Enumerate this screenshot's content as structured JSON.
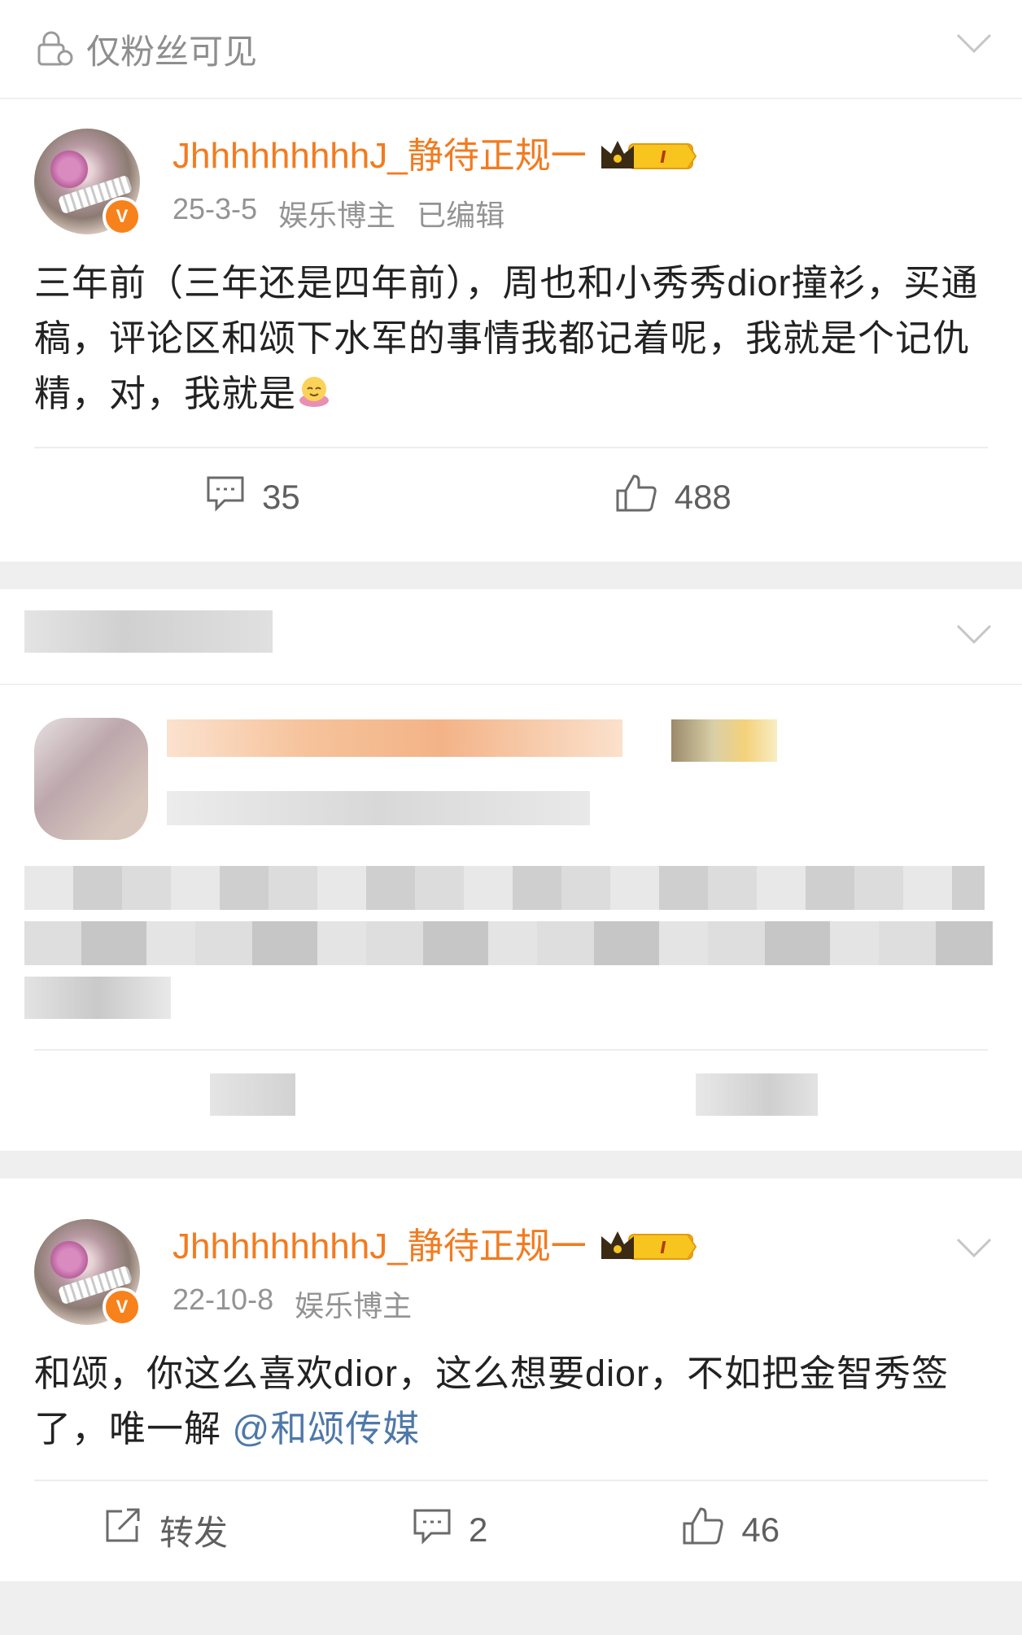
{
  "post1": {
    "visibility_label": "仅粉丝可见",
    "username": "JhhhhhhhhhJ_静待正规一",
    "badge_level": "I",
    "date": "25-3-5",
    "role": "娱乐博主",
    "edited": "已编辑",
    "text": "三年前（三年还是四年前），周也和小秀秀dior撞衫，买通稿，评论区和颂下水军的事情我都记着呢，我就是个记仇精，对，我就是",
    "comments": "35",
    "likes": "488"
  },
  "post2": {
    "visibility_label": "",
    "username": "JhhhhhhhhhJ_静待正规一",
    "edited": "已编辑",
    "note": "content pixelated"
  },
  "post3": {
    "username": "JhhhhhhhhhJ_静待正规一",
    "badge_level": "I",
    "date": "22-10-8",
    "role": "娱乐博主",
    "text": "和颂，你这么喜欢dior，这么想要dior，不如把金智秀签了，唯一解 ",
    "mention": "@和颂传媒",
    "repost_label": "转发",
    "comments": "2",
    "likes": "46"
  },
  "icons": {
    "lock": "lock-person-icon",
    "chevron": "chevron-down-icon",
    "comment": "comment-icon",
    "like": "thumbs-up-icon",
    "repost": "share-icon",
    "verified": "verified-v-badge"
  },
  "colors": {
    "username": "#f27b20",
    "mention": "#4e78a8",
    "verified": "#f7821c"
  }
}
